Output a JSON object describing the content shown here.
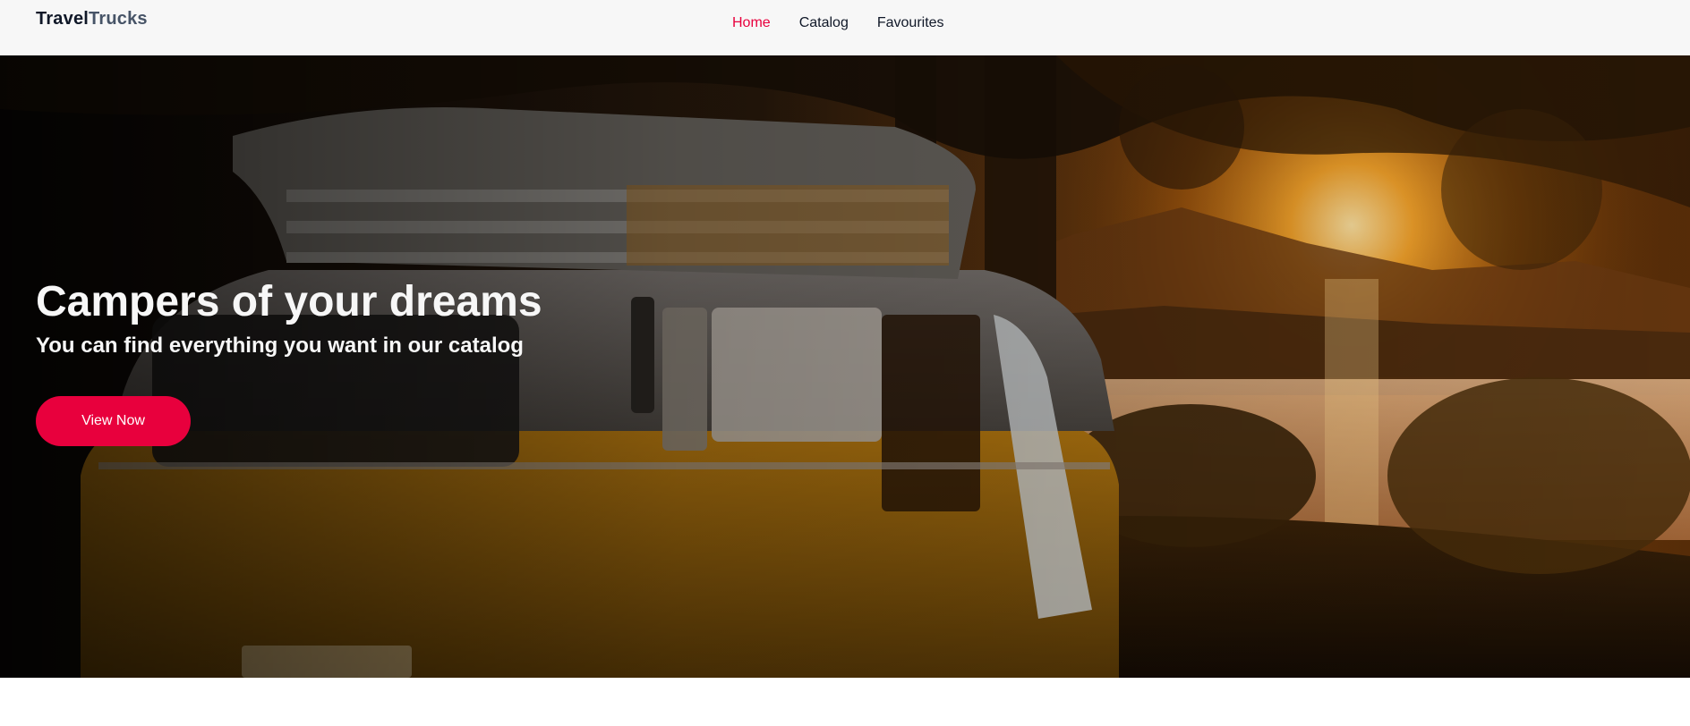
{
  "header": {
    "logo": {
      "part1": "Travel",
      "part2": "Trucks"
    },
    "nav": [
      {
        "label": "Home",
        "active": true
      },
      {
        "label": "Catalog",
        "active": false
      },
      {
        "label": "Favourites",
        "active": false
      }
    ]
  },
  "hero": {
    "title": "Campers of your dreams",
    "subtitle": "You can find everything you want in our catalog",
    "button_label": "View Now",
    "background_image": "camper-van-sunset-lake-image"
  },
  "colors": {
    "accent": "#e8003d",
    "header_bg": "#f7f7f7",
    "logo_dark": "#101828",
    "logo_gray": "#475467",
    "hero_text": "#f7f7f7"
  }
}
